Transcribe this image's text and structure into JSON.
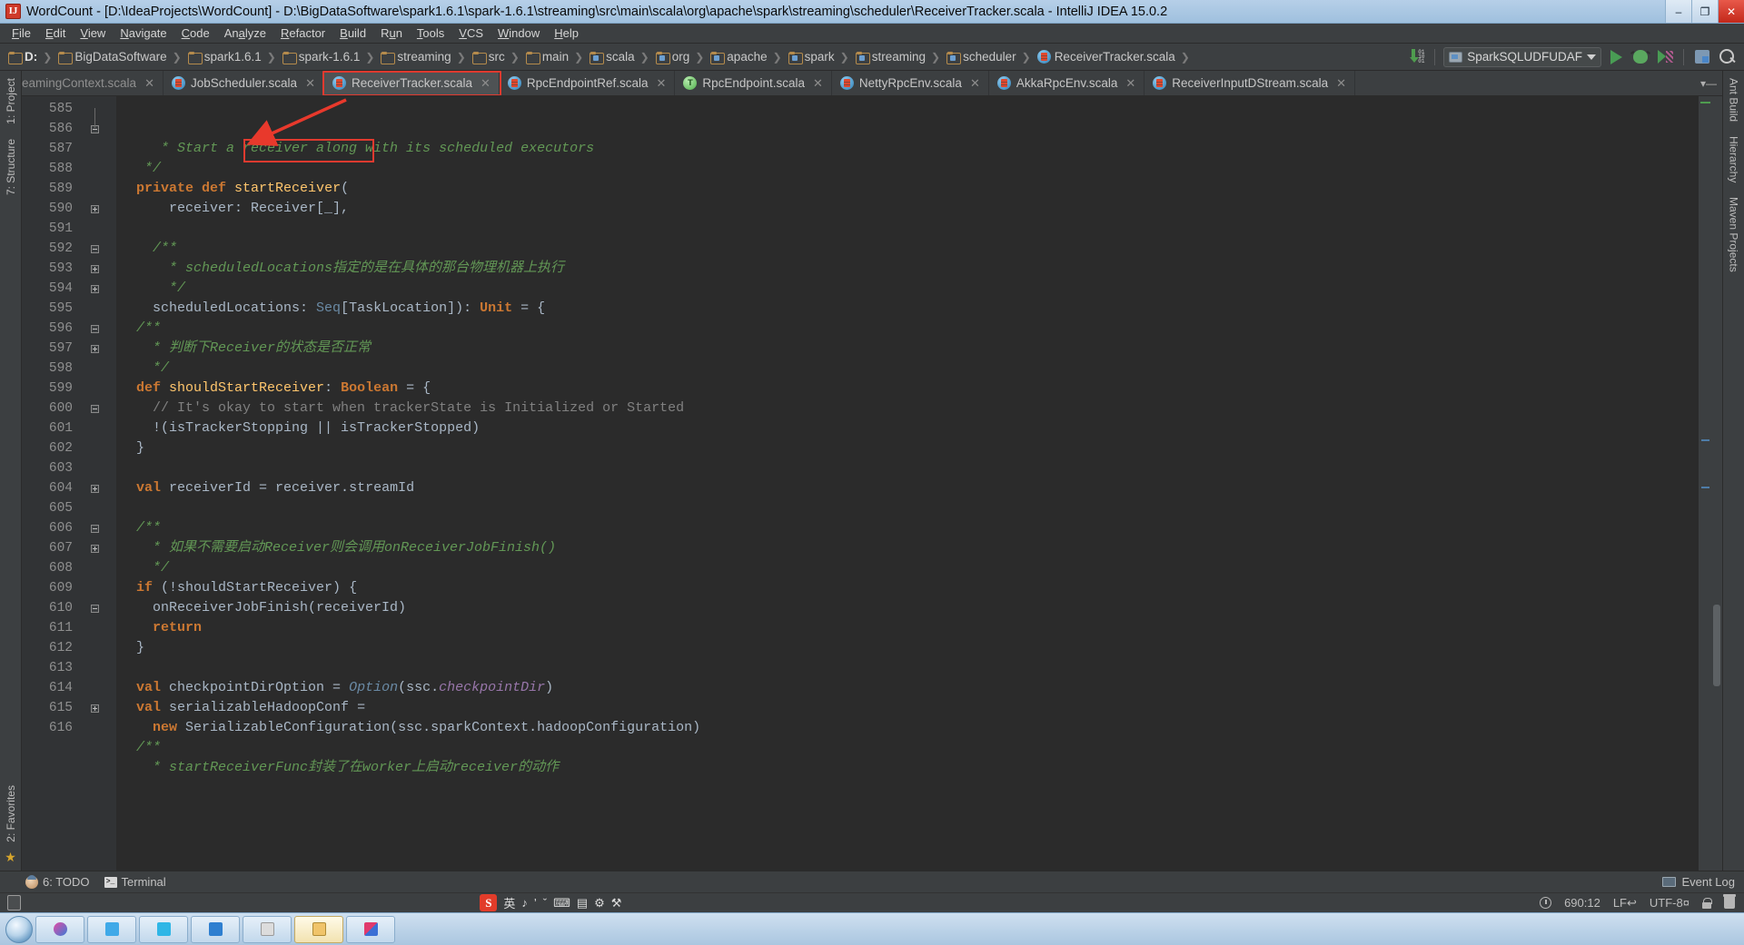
{
  "window": {
    "title": "WordCount - [D:\\IdeaProjects\\WordCount] - D:\\BigDataSoftware\\spark1.6.1\\spark-1.6.1\\streaming\\src\\main\\scala\\org\\apache\\spark\\streaming\\scheduler\\ReceiverTracker.scala - IntelliJ IDEA 15.0.2",
    "minimize": "–",
    "maximize": "❐",
    "close": "✕"
  },
  "menu": {
    "items": [
      "File",
      "Edit",
      "View",
      "Navigate",
      "Code",
      "Analyze",
      "Refactor",
      "Build",
      "Run",
      "Tools",
      "VCS",
      "Window",
      "Help"
    ]
  },
  "breadcrumbs": [
    {
      "label": "D:",
      "icon": "folder-icon"
    },
    {
      "label": "BigDataSoftware",
      "icon": "folder-icon"
    },
    {
      "label": "spark1.6.1",
      "icon": "folder-icon"
    },
    {
      "label": "spark-1.6.1",
      "icon": "folder-icon"
    },
    {
      "label": "streaming",
      "icon": "folder-icon"
    },
    {
      "label": "src",
      "icon": "folder-icon"
    },
    {
      "label": "main",
      "icon": "folder-icon"
    },
    {
      "label": "scala",
      "icon": "package-icon"
    },
    {
      "label": "org",
      "icon": "package-icon"
    },
    {
      "label": "apache",
      "icon": "package-icon"
    },
    {
      "label": "spark",
      "icon": "package-icon"
    },
    {
      "label": "streaming",
      "icon": "package-icon"
    },
    {
      "label": "scheduler",
      "icon": "package-icon"
    },
    {
      "label": "ReceiverTracker.scala",
      "icon": "scala-class-icon"
    }
  ],
  "toolbar": {
    "run_config": "SparkSQLUDFUDAF",
    "run_tooltip": "Run",
    "debug_tooltip": "Debug",
    "coverage_tooltip": "Run with Coverage",
    "stack_tooltip": "Analyze Stacktrace",
    "search_tooltip": "Search Everywhere",
    "update_tooltip": "Update Project"
  },
  "editor_tabs": [
    {
      "label": "eamingContext.scala",
      "icon": "scala-class-icon",
      "active": false,
      "clipped": true
    },
    {
      "label": "JobScheduler.scala",
      "icon": "scala-class-icon",
      "active": false,
      "clipped": false
    },
    {
      "label": "ReceiverTracker.scala",
      "icon": "scala-class-icon",
      "active": true,
      "clipped": false
    },
    {
      "label": "RpcEndpointRef.scala",
      "icon": "scala-class-icon",
      "active": false,
      "clipped": false
    },
    {
      "label": "RpcEndpoint.scala",
      "icon": "scala-trait-icon",
      "active": false,
      "clipped": false
    },
    {
      "label": "NettyRpcEnv.scala",
      "icon": "scala-class-icon",
      "active": false,
      "clipped": false
    },
    {
      "label": "AkkaRpcEnv.scala",
      "icon": "scala-class-icon",
      "active": false,
      "clipped": false
    },
    {
      "label": "ReceiverInputDStream.scala",
      "icon": "scala-class-icon",
      "active": false,
      "clipped": false
    }
  ],
  "left_strip": [
    "1: Project",
    "7: Structure"
  ],
  "left_strip_bottom": [
    "2: Favorites"
  ],
  "right_strip": [
    "Ant Build",
    "Hierarchy",
    "Maven Projects"
  ],
  "editor": {
    "first_line": 585,
    "highlight_text": "startReceiver(",
    "lines": [
      {
        "n": 585,
        "fold": "none",
        "code": "     <span class=\"cm\">* Start a receiver along with its scheduled executors</span>"
      },
      {
        "n": 586,
        "fold": "end",
        "code": "   <span class=\"cm\">*/</span>"
      },
      {
        "n": 587,
        "fold": "none",
        "code": "  <span class=\"kw\">private def </span><span class=\"fn\">startReceiver</span><span class=\"plain\">(</span>"
      },
      {
        "n": 588,
        "fold": "none",
        "code": "      <span class=\"plain\">receiver: Receiver[_],</span>"
      },
      {
        "n": 589,
        "fold": "none",
        "code": ""
      },
      {
        "n": 590,
        "fold": "start",
        "code": "    <span class=\"cm\">/**</span>"
      },
      {
        "n": 591,
        "fold": "none",
        "code": "      <span class=\"cm\">* scheduledLocations指定的是在具体的那台物理机器上执行</span>"
      },
      {
        "n": 592,
        "fold": "end",
        "code": "      <span class=\"cm\">*/</span>"
      },
      {
        "n": 593,
        "fold": "start",
        "code": "    <span class=\"plain\">scheduledLocations: </span><span class=\"ty\">Seq</span><span class=\"plain\">[TaskLocation]): </span><span class=\"kw\">Unit </span><span class=\"plain\">= {</span>"
      },
      {
        "n": 594,
        "fold": "start",
        "code": "  <span class=\"cm\">/**</span>"
      },
      {
        "n": 595,
        "fold": "none",
        "code": "    <span class=\"cm\">* 判断下Receiver的状态是否正常</span>"
      },
      {
        "n": 596,
        "fold": "end",
        "code": "    <span class=\"cm\">*/</span>"
      },
      {
        "n": 597,
        "fold": "start",
        "code": "  <span class=\"kw\">def </span><span class=\"fn\">shouldStartReceiver</span><span class=\"plain\">: </span><span class=\"kw\">Boolean </span><span class=\"plain\">= {</span>"
      },
      {
        "n": 598,
        "fold": "none",
        "code": "    <span class=\"cm2\">// It's okay to start when trackerState is Initialized or Started</span>"
      },
      {
        "n": 599,
        "fold": "none",
        "code": "    <span class=\"plain\">!(isTrackerStopping || isTrackerStopped)</span>"
      },
      {
        "n": 600,
        "fold": "end",
        "code": "  <span class=\"plain\">}</span>"
      },
      {
        "n": 601,
        "fold": "none",
        "code": ""
      },
      {
        "n": 602,
        "fold": "none",
        "code": "  <span class=\"kw\">val </span><span class=\"plain\">receiverId = receiver.streamId</span>"
      },
      {
        "n": 603,
        "fold": "none",
        "code": ""
      },
      {
        "n": 604,
        "fold": "start",
        "code": "  <span class=\"cm\">/**</span>"
      },
      {
        "n": 605,
        "fold": "none",
        "code": "    <span class=\"cm\">* 如果不需要启动Receiver则会调用onReceiverJobFinish()</span>"
      },
      {
        "n": 606,
        "fold": "end",
        "code": "    <span class=\"cm\">*/</span>"
      },
      {
        "n": 607,
        "fold": "start",
        "code": "  <span class=\"kw\">if </span><span class=\"plain\">(!shouldStartReceiver) {</span>"
      },
      {
        "n": 608,
        "fold": "none",
        "code": "    <span class=\"plain\">onReceiverJobFinish(receiverId)</span>"
      },
      {
        "n": 609,
        "fold": "none",
        "code": "    <span class=\"kw\">return</span>"
      },
      {
        "n": 610,
        "fold": "end",
        "code": "  <span class=\"plain\">}</span>"
      },
      {
        "n": 611,
        "fold": "none",
        "code": ""
      },
      {
        "n": 612,
        "fold": "none",
        "code": "  <span class=\"kw\">val </span><span class=\"plain\">checkpointDirOption = </span><span class=\"ty\"><i>Option</i></span><span class=\"plain\">(ssc.</span><span class=\"fld\">checkpointDir</span><span class=\"plain\">)</span>"
      },
      {
        "n": 613,
        "fold": "none",
        "code": "  <span class=\"kw\">val </span><span class=\"plain\">serializableHadoopConf =</span>"
      },
      {
        "n": 614,
        "fold": "none",
        "code": "    <span class=\"kw\">new </span><span class=\"plain\">SerializableConfiguration(ssc.sparkContext.hadoopConfiguration)</span>"
      },
      {
        "n": 615,
        "fold": "start",
        "code": "  <span class=\"cm\">/**</span>"
      },
      {
        "n": 616,
        "fold": "none",
        "code": "    <span class=\"cm\">* startReceiverFunc封装了在worker上启动receiver的动作</span>"
      }
    ]
  },
  "tool_window_bar": {
    "todo": "6: TODO",
    "todo_mnemonic": "6:",
    "terminal": "Terminal",
    "event_log": "Event Log"
  },
  "ide_status": {
    "caret": "690:12",
    "line_separator": "LF↩",
    "encoding": "UTF-8¤",
    "lock": "lock-icon",
    "trash": "trash-icon"
  },
  "ime": {
    "logo": "S",
    "mode": "英",
    "tools": [
      "♪",
      "’",
      "ˇ",
      "⌨",
      "▤",
      "⚙",
      "⚒"
    ]
  },
  "taskbar": {
    "items": [
      "browser",
      "media",
      "blue-app",
      "cyan-app",
      "blue-folder",
      "note",
      "explorer",
      "idea"
    ]
  },
  "colors": {
    "accent_red": "#e03a2f",
    "editor_bg": "#2b2b2b",
    "gutter_bg": "#313335",
    "chrome_bg": "#3c3f41",
    "keyword": "#cc7832",
    "comment": "#629755",
    "method": "#ffc66d",
    "type": "#6a8aa5",
    "field": "#9876aa",
    "text": "#a9b7c6"
  }
}
